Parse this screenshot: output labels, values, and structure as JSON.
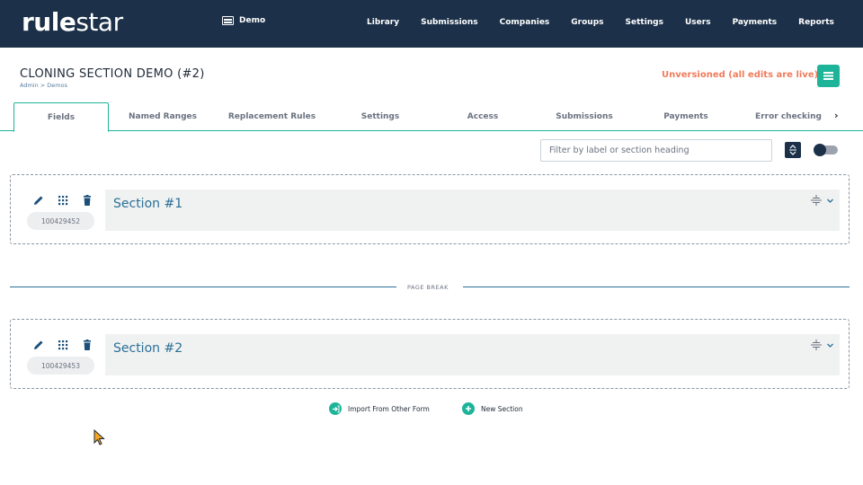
{
  "app": {
    "logo_bold": "rule",
    "logo_light": "star",
    "workspace": "Demo"
  },
  "nav": {
    "items": [
      "Library",
      "Submissions",
      "Companies",
      "Groups",
      "Settings",
      "Users",
      "Payments",
      "Reports"
    ]
  },
  "page": {
    "title": "CLONING SECTION DEMO (#2)",
    "breadcrumb": "Admin > Demos",
    "status": "Unversioned (all edits are live)"
  },
  "tabs": [
    {
      "label": "Fields",
      "active": true
    },
    {
      "label": "Named Ranges",
      "active": false
    },
    {
      "label": "Replacement Rules",
      "active": false
    },
    {
      "label": "Settings",
      "active": false
    },
    {
      "label": "Access",
      "active": false
    },
    {
      "label": "Submissions",
      "active": false
    },
    {
      "label": "Payments",
      "active": false
    },
    {
      "label": "Error checking",
      "active": false
    }
  ],
  "toolbar": {
    "filter_placeholder": "Filter by label or section heading",
    "filter_value": "",
    "toggle_on": false
  },
  "sections": [
    {
      "title": "Section #1",
      "id": "100429452"
    },
    {
      "title": "Section #2",
      "id": "100429453"
    }
  ],
  "page_break": {
    "label": "PAGE BREAK"
  },
  "actions": {
    "import_label": "Import From Other Form",
    "new_section_label": "New Section"
  },
  "colors": {
    "topbar": "#1c3149",
    "accent": "#1db49a",
    "status": "#f07b5c",
    "section_title": "#2b6f96"
  }
}
